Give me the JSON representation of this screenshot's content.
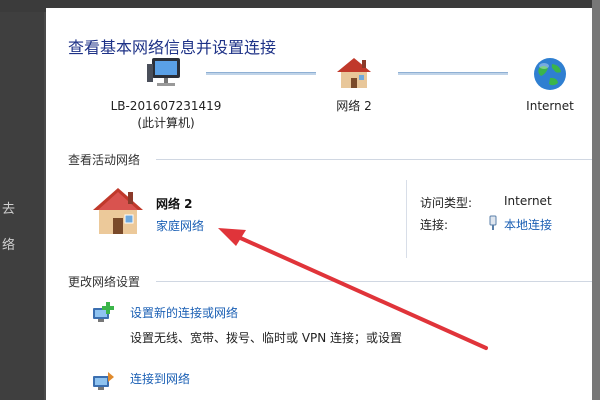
{
  "window": {
    "title": "查看基本网络信息并设置连接"
  },
  "background": {
    "left_glyphs": [
      "去",
      "络"
    ]
  },
  "network_map": {
    "nodes": [
      {
        "label": "LB-201607231419",
        "sublabel": "(此计算机)",
        "icon": "computer-icon"
      },
      {
        "label": "网络  2",
        "sublabel": "",
        "icon": "house-icon"
      },
      {
        "label": "Internet",
        "sublabel": "",
        "icon": "globe-icon"
      }
    ]
  },
  "active_networks": {
    "header": "查看活动网络",
    "network_name": "网络  2",
    "network_type": "家庭网络",
    "access_type_label": "访问类型:",
    "access_type_value": "Internet",
    "connection_label": "连接:",
    "connection_value": "本地连接"
  },
  "change_settings": {
    "header": "更改网络设置",
    "tasks": [
      {
        "title": "设置新的连接或网络",
        "description": "设置无线、宽带、拨号、临时或 VPN 连接；或设置",
        "icon": "new-connection-icon"
      },
      {
        "title": "连接到网络",
        "description": "",
        "icon": "connect-network-icon"
      }
    ]
  },
  "colors": {
    "link": "#1a5fb4",
    "title": "#1e3287",
    "annotation_arrow": "#e0343a"
  }
}
